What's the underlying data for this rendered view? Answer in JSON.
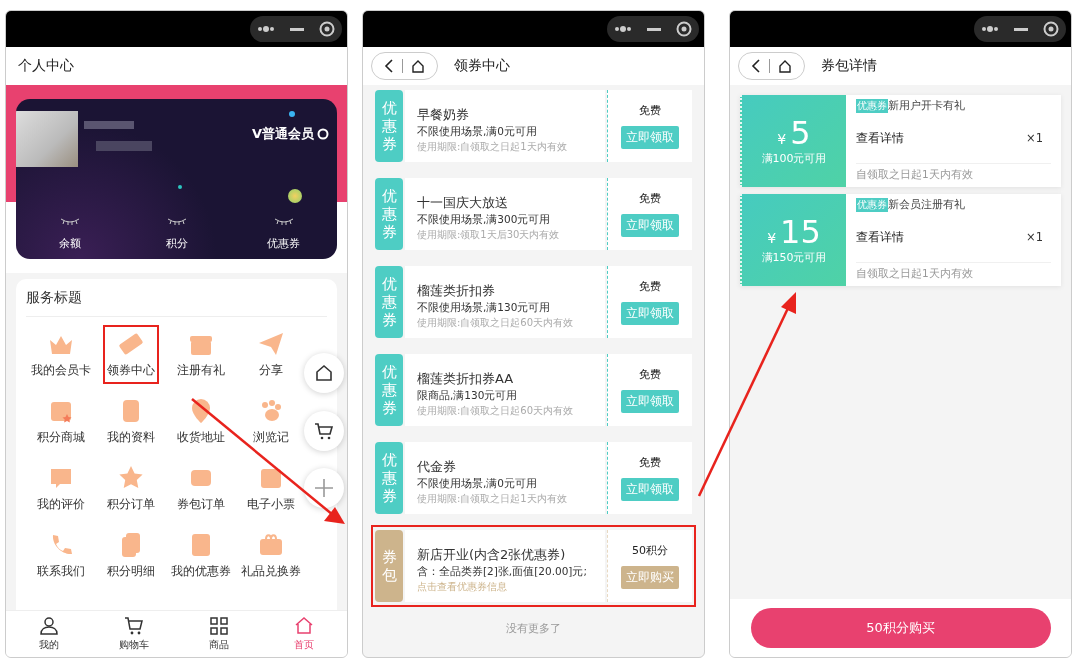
{
  "profile_screen": {
    "title": "个人中心",
    "member_level": "V普通会员",
    "stats": [
      "余额",
      "积分",
      "优惠券"
    ],
    "services_title": "服务标题",
    "services": [
      {
        "label": "我的会员卡",
        "highlighted": false
      },
      {
        "label": "领券中心",
        "highlighted": true
      },
      {
        "label": "注册有礼",
        "highlighted": false
      },
      {
        "label": "分享",
        "highlighted": false
      },
      {
        "label": "积分商城",
        "highlighted": false
      },
      {
        "label": "我的资料",
        "highlighted": false
      },
      {
        "label": "收货地址",
        "highlighted": false
      },
      {
        "label": "浏览记",
        "highlighted": false
      },
      {
        "label": "我的评价",
        "highlighted": false
      },
      {
        "label": "积分订单",
        "highlighted": false
      },
      {
        "label": "券包订单",
        "highlighted": false
      },
      {
        "label": "电子小票",
        "highlighted": false
      },
      {
        "label": "联系我们",
        "highlighted": false
      },
      {
        "label": "积分明细",
        "highlighted": false
      },
      {
        "label": "我的优惠券",
        "highlighted": false
      },
      {
        "label": "礼品兑换券",
        "highlighted": false
      }
    ],
    "tabs": [
      {
        "label": "我的",
        "selected": false
      },
      {
        "label": "购物车",
        "selected": false
      },
      {
        "label": "商品",
        "selected": false
      },
      {
        "label": "首页",
        "selected": true
      }
    ]
  },
  "coupon_center_screen": {
    "title": "领券中心",
    "items": [
      {
        "kind": "coupon",
        "tag": "优惠券",
        "title": "早餐奶券",
        "condition": "不限使用场景,满0元可用",
        "note": "使用期限:自领取之日起1天内有效",
        "price": "免费",
        "button": "立即领取",
        "highlighted": false
      },
      {
        "kind": "coupon",
        "tag": "优惠券",
        "title": "十一国庆大放送",
        "condition": "不限使用场景,满300元可用",
        "note": "使用期限:领取1天后30天内有效",
        "price": "免费",
        "button": "立即领取",
        "highlighted": false
      },
      {
        "kind": "coupon",
        "tag": "优惠券",
        "title": "榴莲类折扣券",
        "condition": "不限使用场景,满130元可用",
        "note": "使用期限:自领取之日起60天内有效",
        "price": "免费",
        "button": "立即领取",
        "highlighted": false
      },
      {
        "kind": "coupon",
        "tag": "优惠券",
        "title": "榴莲类折扣券AA",
        "condition": "限商品,满130元可用",
        "note": "使用期限:自领取之日起60天内有效",
        "price": "免费",
        "button": "立即领取",
        "highlighted": false
      },
      {
        "kind": "coupon",
        "tag": "优惠券",
        "title": "代金券",
        "condition": "不限使用场景,满0元可用",
        "note": "使用期限:自领取之日起1天内有效",
        "price": "免费",
        "button": "立即领取",
        "highlighted": false
      },
      {
        "kind": "package",
        "tag": "券包",
        "title": "新店开业(内含2张优惠券)",
        "condition": "含：全品类券[2]张,面值[20.00]元;",
        "note": "点击查看优惠券信息",
        "price": "50积分",
        "button": "立即购买",
        "highlighted": true
      }
    ],
    "footer": "没有更多了"
  },
  "package_detail_screen": {
    "title": "券包详情",
    "coupons": [
      {
        "currency": "¥",
        "amount": "5",
        "condition": "满100元可用",
        "tag": "优惠券",
        "name": "新用户开卡有礼",
        "link": "查看详情",
        "quantity": "×1",
        "validity": "自领取之日起1天内有效"
      },
      {
        "currency": "¥",
        "amount": "15",
        "condition": "满150元可用",
        "tag": "优惠券",
        "name": "新会员注册有礼",
        "link": "查看详情",
        "quantity": "×1",
        "validity": "自领取之日起1天内有效"
      }
    ],
    "buy_button": "50积分购买"
  }
}
